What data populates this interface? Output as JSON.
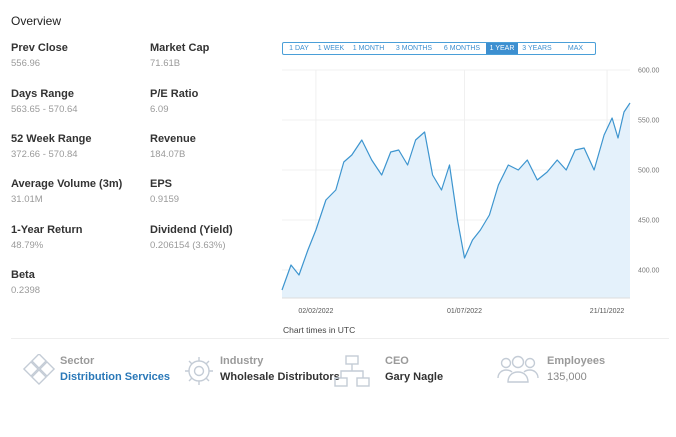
{
  "overview": {
    "title": "Overview"
  },
  "stats": [
    {
      "label": "Prev Close",
      "value": "556.96"
    },
    {
      "label": "Market Cap",
      "value": "71.61B"
    },
    {
      "label": "Days Range",
      "value": "563.65 - 570.64"
    },
    {
      "label": "P/E Ratio",
      "value": "6.09"
    },
    {
      "label": "52 Week Range",
      "value": "372.66 - 570.84"
    },
    {
      "label": "Revenue",
      "value": "184.07B"
    },
    {
      "label": "Average Volume (3m)",
      "value": "31.01M"
    },
    {
      "label": "EPS",
      "value": "0.9159"
    },
    {
      "label": "1-Year Return",
      "value": "48.79%"
    },
    {
      "label": "Dividend (Yield)",
      "value": "0.206154 (3.63%)"
    },
    {
      "label": "Beta",
      "value": "0.2398"
    }
  ],
  "ranges": {
    "options": [
      "1 DAY",
      "1 WEEK",
      "1 MONTH",
      "3 MONTHS",
      "6 MONTHS",
      "1 YEAR",
      "3 YEARS",
      "MAX"
    ],
    "selected": "1 YEAR"
  },
  "chart_data": {
    "type": "area",
    "x": [
      "2021-12-30",
      "2022-01-08",
      "2022-01-16",
      "2022-01-25",
      "2022-02-02",
      "2022-02-12",
      "2022-02-22",
      "2022-03-02",
      "2022-03-10",
      "2022-03-20",
      "2022-03-30",
      "2022-04-09",
      "2022-04-18",
      "2022-04-26",
      "2022-05-05",
      "2022-05-13",
      "2022-05-22",
      "2022-05-30",
      "2022-06-08",
      "2022-06-16",
      "2022-06-24",
      "2022-07-01",
      "2022-07-09",
      "2022-07-17",
      "2022-07-26",
      "2022-08-04",
      "2022-08-14",
      "2022-08-24",
      "2022-09-02",
      "2022-09-12",
      "2022-09-22",
      "2022-10-02",
      "2022-10-11",
      "2022-10-20",
      "2022-10-29",
      "2022-11-08",
      "2022-11-18",
      "2022-11-26",
      "2022-12-02",
      "2022-12-08",
      "2022-12-14"
    ],
    "values": [
      380,
      405,
      395,
      420,
      440,
      470,
      480,
      508,
      515,
      530,
      510,
      495,
      518,
      520,
      505,
      530,
      538,
      495,
      480,
      505,
      450,
      412,
      430,
      440,
      455,
      485,
      505,
      500,
      510,
      490,
      498,
      510,
      500,
      520,
      522,
      500,
      535,
      552,
      532,
      558,
      567
    ],
    "ylim": [
      372,
      600
    ],
    "yticks": [
      "600.00",
      "550.00",
      "500.00",
      "450.00",
      "400.00"
    ],
    "xticks": [
      "02/02/2022",
      "01/07/2022",
      "21/11/2022"
    ],
    "line_color": "#3d95cf",
    "fill_color": "#e4f1fb",
    "grid": true,
    "note": "Chart times in UTC"
  },
  "info_cards": [
    {
      "icon": "sector-icon",
      "label": "Sector",
      "value": "Distribution Services"
    },
    {
      "icon": "industry-icon",
      "label": "Industry",
      "value": "Wholesale Distributors"
    },
    {
      "icon": "ceo-icon",
      "label": "CEO",
      "value": "Gary Nagle"
    },
    {
      "icon": "employees-icon",
      "label": "Employees",
      "value": "135,000"
    }
  ]
}
